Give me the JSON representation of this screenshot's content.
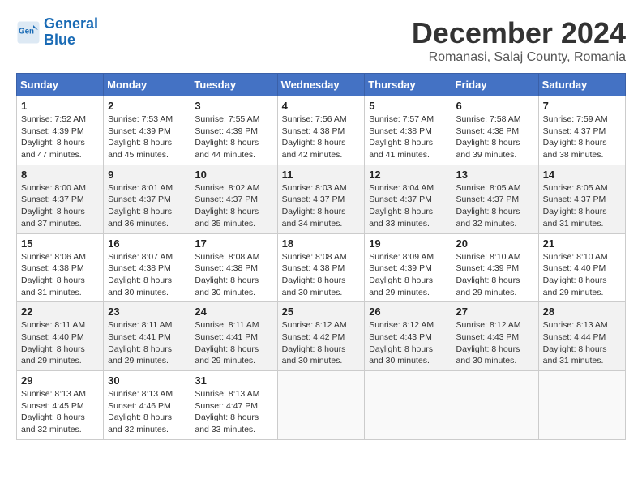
{
  "logo": {
    "line1": "General",
    "line2": "Blue"
  },
  "title": "December 2024",
  "subtitle": "Romanasi, Salaj County, Romania",
  "weekdays": [
    "Sunday",
    "Monday",
    "Tuesday",
    "Wednesday",
    "Thursday",
    "Friday",
    "Saturday"
  ],
  "weeks": [
    [
      {
        "day": "1",
        "sunrise": "7:52 AM",
        "sunset": "4:39 PM",
        "daylight": "8 hours and 47 minutes."
      },
      {
        "day": "2",
        "sunrise": "7:53 AM",
        "sunset": "4:39 PM",
        "daylight": "8 hours and 45 minutes."
      },
      {
        "day": "3",
        "sunrise": "7:55 AM",
        "sunset": "4:39 PM",
        "daylight": "8 hours and 44 minutes."
      },
      {
        "day": "4",
        "sunrise": "7:56 AM",
        "sunset": "4:38 PM",
        "daylight": "8 hours and 42 minutes."
      },
      {
        "day": "5",
        "sunrise": "7:57 AM",
        "sunset": "4:38 PM",
        "daylight": "8 hours and 41 minutes."
      },
      {
        "day": "6",
        "sunrise": "7:58 AM",
        "sunset": "4:38 PM",
        "daylight": "8 hours and 39 minutes."
      },
      {
        "day": "7",
        "sunrise": "7:59 AM",
        "sunset": "4:37 PM",
        "daylight": "8 hours and 38 minutes."
      }
    ],
    [
      {
        "day": "8",
        "sunrise": "8:00 AM",
        "sunset": "4:37 PM",
        "daylight": "8 hours and 37 minutes."
      },
      {
        "day": "9",
        "sunrise": "8:01 AM",
        "sunset": "4:37 PM",
        "daylight": "8 hours and 36 minutes."
      },
      {
        "day": "10",
        "sunrise": "8:02 AM",
        "sunset": "4:37 PM",
        "daylight": "8 hours and 35 minutes."
      },
      {
        "day": "11",
        "sunrise": "8:03 AM",
        "sunset": "4:37 PM",
        "daylight": "8 hours and 34 minutes."
      },
      {
        "day": "12",
        "sunrise": "8:04 AM",
        "sunset": "4:37 PM",
        "daylight": "8 hours and 33 minutes."
      },
      {
        "day": "13",
        "sunrise": "8:05 AM",
        "sunset": "4:37 PM",
        "daylight": "8 hours and 32 minutes."
      },
      {
        "day": "14",
        "sunrise": "8:05 AM",
        "sunset": "4:37 PM",
        "daylight": "8 hours and 31 minutes."
      }
    ],
    [
      {
        "day": "15",
        "sunrise": "8:06 AM",
        "sunset": "4:38 PM",
        "daylight": "8 hours and 31 minutes."
      },
      {
        "day": "16",
        "sunrise": "8:07 AM",
        "sunset": "4:38 PM",
        "daylight": "8 hours and 30 minutes."
      },
      {
        "day": "17",
        "sunrise": "8:08 AM",
        "sunset": "4:38 PM",
        "daylight": "8 hours and 30 minutes."
      },
      {
        "day": "18",
        "sunrise": "8:08 AM",
        "sunset": "4:38 PM",
        "daylight": "8 hours and 30 minutes."
      },
      {
        "day": "19",
        "sunrise": "8:09 AM",
        "sunset": "4:39 PM",
        "daylight": "8 hours and 29 minutes."
      },
      {
        "day": "20",
        "sunrise": "8:10 AM",
        "sunset": "4:39 PM",
        "daylight": "8 hours and 29 minutes."
      },
      {
        "day": "21",
        "sunrise": "8:10 AM",
        "sunset": "4:40 PM",
        "daylight": "8 hours and 29 minutes."
      }
    ],
    [
      {
        "day": "22",
        "sunrise": "8:11 AM",
        "sunset": "4:40 PM",
        "daylight": "8 hours and 29 minutes."
      },
      {
        "day": "23",
        "sunrise": "8:11 AM",
        "sunset": "4:41 PM",
        "daylight": "8 hours and 29 minutes."
      },
      {
        "day": "24",
        "sunrise": "8:11 AM",
        "sunset": "4:41 PM",
        "daylight": "8 hours and 29 minutes."
      },
      {
        "day": "25",
        "sunrise": "8:12 AM",
        "sunset": "4:42 PM",
        "daylight": "8 hours and 30 minutes."
      },
      {
        "day": "26",
        "sunrise": "8:12 AM",
        "sunset": "4:43 PM",
        "daylight": "8 hours and 30 minutes."
      },
      {
        "day": "27",
        "sunrise": "8:12 AM",
        "sunset": "4:43 PM",
        "daylight": "8 hours and 30 minutes."
      },
      {
        "day": "28",
        "sunrise": "8:13 AM",
        "sunset": "4:44 PM",
        "daylight": "8 hours and 31 minutes."
      }
    ],
    [
      {
        "day": "29",
        "sunrise": "8:13 AM",
        "sunset": "4:45 PM",
        "daylight": "8 hours and 32 minutes."
      },
      {
        "day": "30",
        "sunrise": "8:13 AM",
        "sunset": "4:46 PM",
        "daylight": "8 hours and 32 minutes."
      },
      {
        "day": "31",
        "sunrise": "8:13 AM",
        "sunset": "4:47 PM",
        "daylight": "8 hours and 33 minutes."
      },
      null,
      null,
      null,
      null
    ]
  ]
}
